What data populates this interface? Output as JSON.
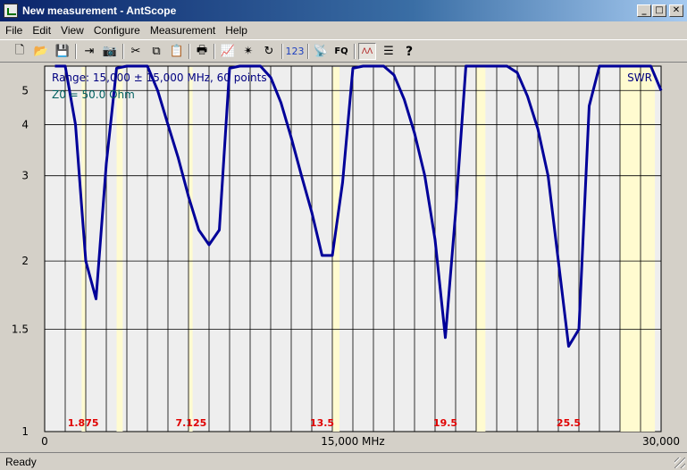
{
  "window": {
    "title": "New measurement - AntScope",
    "icon": "antscope-app-icon",
    "controls": [
      "_",
      "□",
      "✕"
    ]
  },
  "menu": [
    "File",
    "Edit",
    "View",
    "Configure",
    "Measurement",
    "Help"
  ],
  "toolbar": {
    "buttons": [
      {
        "name": "new-icon",
        "glyph": "🗋"
      },
      {
        "name": "open-folder-icon",
        "glyph": "📂"
      },
      {
        "name": "save-icon",
        "glyph": "💾"
      },
      {
        "name": "export-icon",
        "glyph": "⇥"
      },
      {
        "name": "camera-icon",
        "glyph": "📷"
      },
      {
        "name": "cut-icon",
        "glyph": "✂"
      },
      {
        "name": "copy-icon",
        "glyph": "⧉"
      },
      {
        "name": "paste-icon",
        "glyph": "📋"
      },
      {
        "name": "print-icon",
        "glyph": "🖶"
      },
      {
        "name": "chart-icon",
        "glyph": "📈"
      },
      {
        "name": "scan-icon",
        "glyph": "✴"
      },
      {
        "name": "refresh-icon",
        "glyph": "↻"
      },
      {
        "name": "numbers-label",
        "glyph": "123"
      },
      {
        "name": "antenna-icon",
        "glyph": "📡"
      },
      {
        "name": "fq-label",
        "glyph": "FQ"
      },
      {
        "name": "graph-mode-icon",
        "glyph": "ΛΛ"
      },
      {
        "name": "list-icon",
        "glyph": "☰"
      },
      {
        "name": "help-icon",
        "glyph": "?"
      }
    ]
  },
  "chart_data": {
    "type": "line",
    "range_text": "Range: 15,000 ± 15,000 MHz, 60 points",
    "z0_text": "Z0 = 50.0 Ohm",
    "param_label": "SWR",
    "xlim": [
      0,
      30
    ],
    "x_tick_labels": [
      "0",
      "15,000 MHz",
      "30,000"
    ],
    "y_tick_labels": [
      "1",
      "1.5",
      "2",
      "3",
      "4",
      "5"
    ],
    "y_tick_values": [
      1,
      1.5,
      2,
      3,
      4,
      5
    ],
    "band_labels": [
      {
        "x": 1.875,
        "text": "1.875"
      },
      {
        "x": 7.125,
        "text": "7.125"
      },
      {
        "x": 13.5,
        "text": "13.5"
      },
      {
        "x": 19.5,
        "text": "19.5"
      },
      {
        "x": 25.5,
        "text": "25.5"
      }
    ],
    "bands": [
      [
        1.8,
        2.0
      ],
      [
        3.5,
        3.8
      ],
      [
        7.0,
        7.2
      ],
      [
        14.0,
        14.35
      ],
      [
        21.0,
        21.45
      ],
      [
        28.0,
        29.7
      ]
    ],
    "series": [
      {
        "color": "#000099",
        "x": [
          0.5,
          1.0,
          1.5,
          2.0,
          2.5,
          3.0,
          3.5,
          4.0,
          4.5,
          5.0,
          5.5,
          6.0,
          6.5,
          7.0,
          7.5,
          8.0,
          8.5,
          9.0,
          9.5,
          10.0,
          10.5,
          11.0,
          11.5,
          12.0,
          12.5,
          13.0,
          13.5,
          14.0,
          14.5,
          15.0,
          15.5,
          16.0,
          16.5,
          17.0,
          17.5,
          18.0,
          18.5,
          19.0,
          19.5,
          20.0,
          20.5,
          21.0,
          21.5,
          22.0,
          22.5,
          23.0,
          23.5,
          24.0,
          24.5,
          25.0,
          25.5,
          26.0,
          26.5,
          27.0,
          27.5,
          28.0,
          28.5,
          29.0,
          29.5,
          30.0
        ],
        "y": [
          6.0,
          6.0,
          4.0,
          2.0,
          1.7,
          3.2,
          5.9,
          6.0,
          6.0,
          6.0,
          5.0,
          4.0,
          3.3,
          2.7,
          2.3,
          2.15,
          2.3,
          5.9,
          6.0,
          6.0,
          6.0,
          5.5,
          4.6,
          3.7,
          3.0,
          2.5,
          2.05,
          2.05,
          2.9,
          5.9,
          6.0,
          6.0,
          6.0,
          5.6,
          4.7,
          3.8,
          3.0,
          2.2,
          1.45,
          2.5,
          6.0,
          6.0,
          6.0,
          6.0,
          6.0,
          5.7,
          4.8,
          3.9,
          3.0,
          2.0,
          1.4,
          1.5,
          4.5,
          6.0,
          6.0,
          6.0,
          6.0,
          6.0,
          6.0,
          5.0
        ]
      }
    ]
  },
  "status": "Ready"
}
